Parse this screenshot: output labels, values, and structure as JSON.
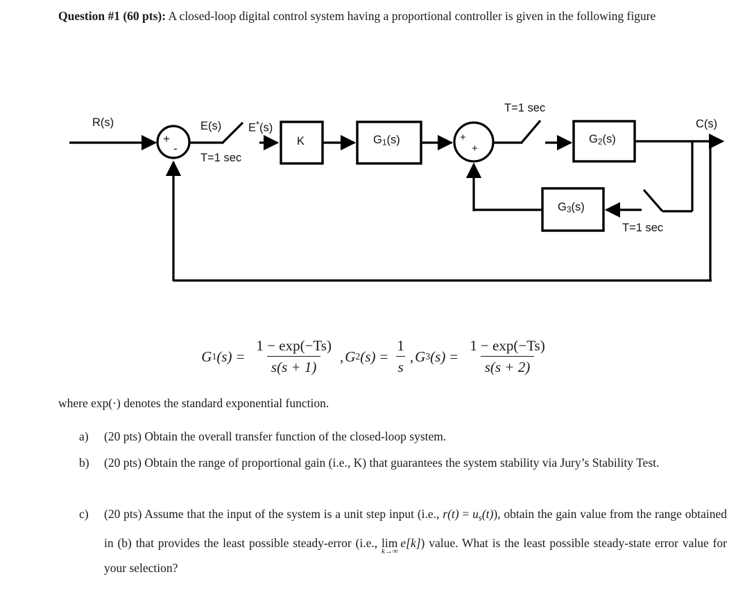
{
  "document": {
    "question_number": "Question #1",
    "question_points": "(60 pts):",
    "question_heading_prefix": "Question #1 (60 pts):",
    "question_heading_rest": "A closed-loop digital control system having a proportional controller is given in the following figure",
    "where_note": "where exp(·) denotes the standard exponential function."
  },
  "formula": {
    "g1_name": "G",
    "g1_sub": "1",
    "g1_arg": "(s)",
    "g1_num": "1 − exp(−Ts)",
    "g1_den": "s(s + 1)",
    "g2_name": "G",
    "g2_sub": "2",
    "g2_arg": "(s)",
    "g2_num": "1",
    "g2_den": "s",
    "g3_name": "G",
    "g3_sub": "3",
    "g3_arg": "(s)",
    "g3_num": "1 − exp(−Ts)",
    "g3_den": "s(s + 2)",
    "equals": "=",
    "comma": ","
  },
  "parts": [
    {
      "marker": "a)",
      "text": "(20 pts) Obtain the overall transfer function of the closed-loop system."
    },
    {
      "marker": "b)",
      "text": "(20 pts) Obtain the range of proportional gain (i.e., K) that guarantees the system stability via Jury’s Stability Test."
    },
    {
      "marker": "c)",
      "text_1": "(20 pts) Assume that the input of the system is a unit step input (i.e., ",
      "rt": "r",
      "rt_arg": "(t)",
      "equals": " = ",
      "us": "u",
      "us_sub": "s",
      "us_arg": "(t)",
      "text_2": "), obtain the gain value from the range obtained in (b) that provides the least possible steady-error (i.e., ",
      "lim_main": "lim",
      "lim_sub": "k→∞",
      "ek": "e",
      "ek_arg": "[k]",
      "text_3": ") value. What is the least possible steady-state error value for your selection?"
    }
  ],
  "diagram": {
    "labels": {
      "input": "R(s)",
      "error": "E(s)",
      "sampled_error_base": "E",
      "sampled_error_star": "*",
      "sampled_error_arg": "(s)",
      "sampler1_period": "T=1 sec",
      "sampler2_period": "T=1 sec",
      "sampler3_period": "T=1 sec",
      "gain_block": "K",
      "g1_block_base": "G",
      "g1_block_sub": "1",
      "g1_block_arg": "(s)",
      "g2_block_base": "G",
      "g2_block_sub": "2",
      "g2_block_arg": "(s)",
      "g3_block_base": "G",
      "g3_block_sub": "3",
      "g3_block_arg": "(s)",
      "output": "C(s)",
      "sum1_plus": "+",
      "sum1_minus": "-",
      "sum2_plus_left": "+",
      "sum2_plus_bottom": "+"
    },
    "colors": {
      "line": "#000000",
      "text": "#111111",
      "background": "#ffffff"
    }
  }
}
